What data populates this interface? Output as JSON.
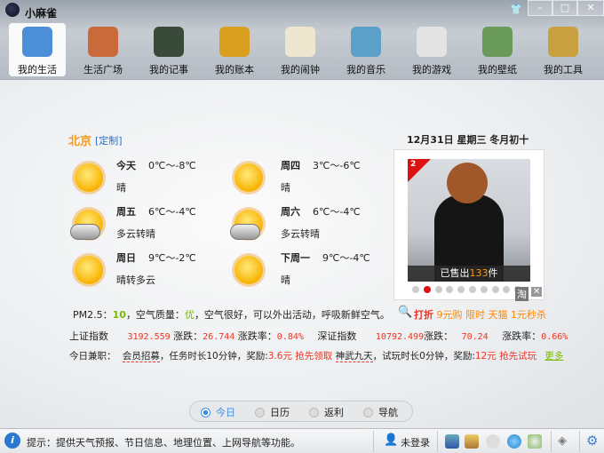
{
  "app": {
    "title": "小麻雀",
    "skin_icon": "shirt-icon",
    "minimize": "–",
    "maximize": "□",
    "close": "✕"
  },
  "nav": [
    {
      "label": "我的生活",
      "icon": "house-icon",
      "color": "#4a8fd8",
      "selected": true
    },
    {
      "label": "生活广场",
      "icon": "cottage-icon",
      "color": "#c86a3a"
    },
    {
      "label": "我的记事",
      "icon": "notebook-icon",
      "color": "#3a4a3a"
    },
    {
      "label": "我的账本",
      "icon": "ledger-icon",
      "color": "#d9a020"
    },
    {
      "label": "我的闹钟",
      "icon": "clock-icon",
      "color": "#efe6d0"
    },
    {
      "label": "我的音乐",
      "icon": "music-icon",
      "color": "#5aa0c8"
    },
    {
      "label": "我的游戏",
      "icon": "gamepad-icon",
      "color": "#e4e4e4"
    },
    {
      "label": "我的壁纸",
      "icon": "wallpaper-icon",
      "color": "#6a9a5a"
    },
    {
      "label": "我的工具",
      "icon": "toolbox-icon",
      "color": "#c8a040"
    }
  ],
  "weather": {
    "city": "北京",
    "customize": "[定制]",
    "days": [
      {
        "day": "今天",
        "temp": "0℃～-8℃",
        "desc": "晴",
        "icon": "sunny-icon"
      },
      {
        "day": "周四",
        "temp": "3℃～-6℃",
        "desc": "晴",
        "icon": "sunny-icon"
      },
      {
        "day": "周五",
        "temp": "6℃～-4℃",
        "desc": "多云转晴",
        "icon": "partly-cloudy-icon"
      },
      {
        "day": "周六",
        "temp": "6℃～-4℃",
        "desc": "多云转晴",
        "icon": "partly-cloudy-icon"
      },
      {
        "day": "周日",
        "temp": "9℃～-2℃",
        "desc": "晴转多云",
        "icon": "sunny-icon"
      },
      {
        "day": "下周一",
        "temp": "9℃～-4℃",
        "desc": "晴",
        "icon": "sunny-icon"
      }
    ]
  },
  "date": "12月31日  星期三  冬月初十",
  "product": {
    "rank": "2",
    "sold_prefix": "已售出",
    "sold_count": "133",
    "sold_suffix": "件",
    "dots": 10,
    "active_dot": 2,
    "taobao": "淘",
    "close": "✕"
  },
  "air": {
    "label": "PM2.5：",
    "value": "10",
    "quality_label": "，空气质量：",
    "quality": "优",
    "text": "，空气很好，可以外出活动，呼吸新鲜空气。"
  },
  "promo": {
    "search_icon": "search-icon",
    "hot": "打折",
    "items": "9元购 限时 天猫 1元秒杀"
  },
  "stocks": {
    "sh_name": "上证指数",
    "sh_value": "3192.559",
    "sh_change_label": "涨跌：",
    "sh_change": "26.744",
    "sh_rate_label": "涨跌率：",
    "sh_rate": "0.84%",
    "sz_name": "深证指数",
    "sz_value": "10792.499",
    "sz_change_label": "涨跌：",
    "sz_change": "70.24",
    "sz_rate_label": "涨跌率：",
    "sz_rate": "0.66%"
  },
  "jobs": {
    "label": "今日兼职：",
    "j1_name": "会员招募",
    "j1_text": "，任务时长10分钟，奖励:",
    "j1_reward": "3.6元",
    "j1_action": "抢先领取",
    "j2_name": "神武九天",
    "j2_text": "，试玩时长0分钟，奖励:",
    "j2_reward": "12元",
    "j2_action": "抢先试玩",
    "more": "更多"
  },
  "tabs": [
    {
      "label": "今日",
      "selected": true
    },
    {
      "label": "日历"
    },
    {
      "label": "返利"
    },
    {
      "label": "导航"
    }
  ],
  "status": {
    "tip": "提示：提供天气预报、节日信息、地理位置、上网导航等功能。",
    "login": "未登录"
  }
}
